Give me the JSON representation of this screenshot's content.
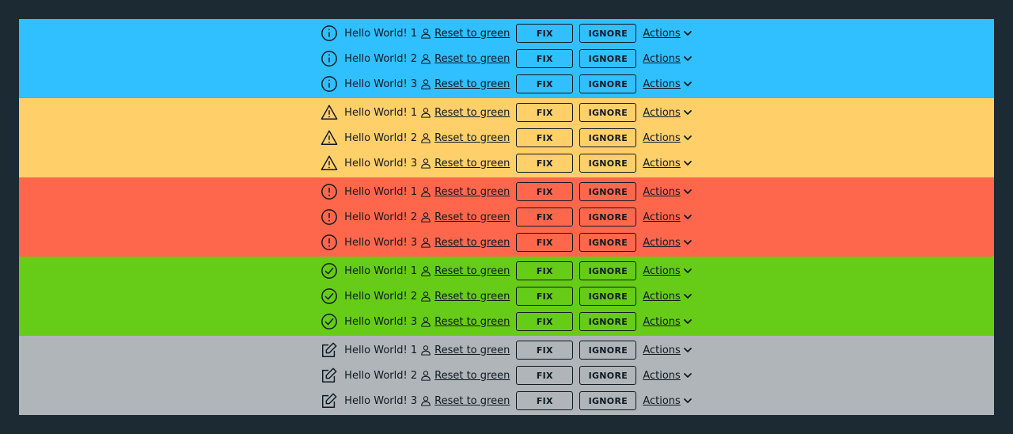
{
  "colors": {
    "background": "#1c2a33",
    "info": "#30bfff",
    "warning": "#ffcf6a",
    "error": "#ff674c",
    "success": "#66cc18",
    "neutral": "#b0b5ba",
    "text": "#0f1a20"
  },
  "labels": {
    "reset": "Reset to green",
    "fix": "FIX",
    "ignore": "IGNORE",
    "actions": "Actions"
  },
  "groups": [
    {
      "type": "info",
      "icon": "info-circle-icon",
      "color_key": "info",
      "rows": [
        {
          "message": "Hello World! 1"
        },
        {
          "message": "Hello World! 2"
        },
        {
          "message": "Hello World! 3"
        }
      ]
    },
    {
      "type": "warning",
      "icon": "warning-triangle-icon",
      "color_key": "warning",
      "rows": [
        {
          "message": "Hello World! 1"
        },
        {
          "message": "Hello World! 2"
        },
        {
          "message": "Hello World! 3"
        }
      ]
    },
    {
      "type": "error",
      "icon": "error-circle-icon",
      "color_key": "error",
      "rows": [
        {
          "message": "Hello World! 1"
        },
        {
          "message": "Hello World! 2"
        },
        {
          "message": "Hello World! 3"
        }
      ]
    },
    {
      "type": "success",
      "icon": "check-circle-icon",
      "color_key": "success",
      "rows": [
        {
          "message": "Hello World! 1"
        },
        {
          "message": "Hello World! 2"
        },
        {
          "message": "Hello World! 3"
        }
      ]
    },
    {
      "type": "neutral",
      "icon": "edit-icon",
      "color_key": "neutral",
      "rows": [
        {
          "message": "Hello World! 1"
        },
        {
          "message": "Hello World! 2"
        },
        {
          "message": "Hello World! 3"
        }
      ]
    }
  ]
}
